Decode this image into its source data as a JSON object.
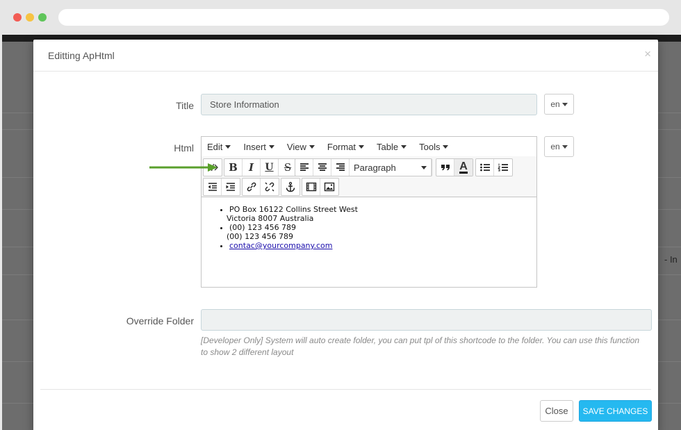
{
  "modal": {
    "title": "Editting ApHtml",
    "close_glyph": "×"
  },
  "form": {
    "title_label": "Title",
    "title_value": "Store Information",
    "lang_title": "en",
    "html_label": "Html",
    "lang_html": "en",
    "override_label": "Override Folder",
    "override_value": "",
    "help_text": "[Developer Only] System will auto create folder, you can put tpl of this shortcode to the folder. You can use this function to show 2 different layout"
  },
  "editor": {
    "menus": [
      "Edit",
      "Insert",
      "View",
      "Format",
      "Table",
      "Tools"
    ],
    "paragraph_select": "Paragraph",
    "toolbar_icons": [
      "source-code-icon",
      "bold-icon",
      "italic-icon",
      "underline-icon",
      "strikethrough-icon",
      "align-left-icon",
      "align-center-icon",
      "align-right-icon",
      "blockquote-icon",
      "text-color-icon",
      "bullet-list-icon",
      "numbered-list-icon",
      "outdent-icon",
      "indent-icon",
      "link-icon",
      "unlink-icon",
      "anchor-icon",
      "media-icon",
      "image-icon"
    ],
    "content": {
      "address_line1": "PO Box 16122 Collins Street West",
      "address_line2": "Victoria 8007 Australia",
      "phone_line1": "(00) 123 456 789",
      "phone_line2": "(00) 123 456 789",
      "email": "contac@yourcompany.com"
    }
  },
  "footer": {
    "close_label": "Close",
    "save_label": "SAVE CHANGES"
  },
  "background": {
    "side_text": "- In"
  },
  "colors": {
    "accent": "#25b9f0",
    "arrow": "#5aa02c"
  }
}
